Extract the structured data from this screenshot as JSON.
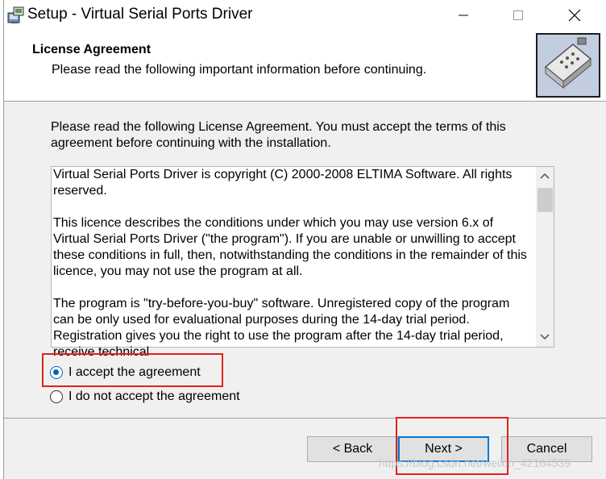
{
  "window": {
    "title": "Setup - Virtual Serial Ports Driver"
  },
  "header": {
    "title": "License Agreement",
    "subtitle": "Please read the following important information before continuing."
  },
  "intro": "Please read the following License Agreement. You must accept the terms of this agreement before continuing with the installation.",
  "license": {
    "paragraphs": [
      "Virtual Serial Ports Driver is copyright (C) 2000-2008 ELTIMA Software. All rights reserved.",
      "This licence describes the conditions under which you may use version 6.x of Virtual Serial Ports Driver (\"the program\"). If you are unable or unwilling to accept these conditions in full, then, notwithstanding the conditions in the remainder of this licence, you may not use the program at all.",
      "The program is \"try-before-you-buy\" software. Unregistered copy of the program can be only used for evaluational purposes during the 14-day trial period. Registration gives you the right to use the program after the 14-day trial period, receive technical"
    ]
  },
  "options": {
    "accept_label": "I accept the agreement",
    "decline_label": "I do not accept the agreement",
    "selected": "accept"
  },
  "buttons": {
    "back": "< Back",
    "next": "Next >",
    "cancel": "Cancel"
  },
  "watermark": "https://blog.csdn.net/weixin_42164539",
  "colors": {
    "highlight": "#e02020",
    "accent": "#0078d7"
  }
}
